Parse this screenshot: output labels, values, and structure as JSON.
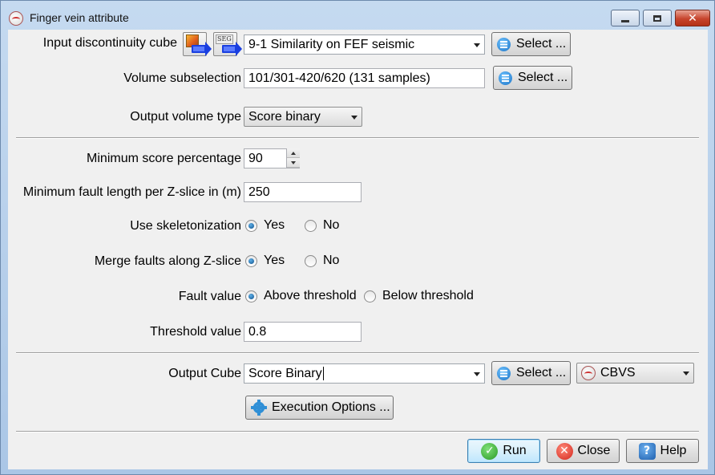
{
  "window": {
    "title": "Finger vein attribute",
    "minimize_glyph": "",
    "restore_glyph": "",
    "close_glyph": "✕"
  },
  "input_cube": {
    "label": "Input discontinuity cube",
    "value": "9-1 Similarity on FEF seismic",
    "select_label": "Select ...",
    "segy_label": "SEG"
  },
  "volume_subselection": {
    "label": "Volume subselection",
    "value": "101/301-420/620 (131 samples)",
    "select_label": "Select ..."
  },
  "output_volume_type": {
    "label": "Output volume type",
    "value": "Score binary"
  },
  "min_score": {
    "label": "Minimum score percentage",
    "value": "90"
  },
  "min_fault_length": {
    "label": "Minimum fault length per Z-slice in (m)",
    "value": "250"
  },
  "skeletonization": {
    "label": "Use skeletonization",
    "yes": "Yes",
    "no": "No",
    "selected": "Yes"
  },
  "merge_faults": {
    "label": "Merge faults along Z-slice",
    "yes": "Yes",
    "no": "No",
    "selected": "Yes"
  },
  "fault_value": {
    "label": "Fault value",
    "above": "Above threshold",
    "below": "Below threshold",
    "selected": "Above threshold"
  },
  "threshold": {
    "label": "Threshold value",
    "value": "0.8"
  },
  "output_cube": {
    "label": "Output Cube",
    "value": "Score Binary",
    "select_label": "Select ...",
    "format": "CBVS"
  },
  "execution_options": {
    "label": "Execution Options ..."
  },
  "footer": {
    "run": "Run",
    "close": "Close",
    "help": "Help"
  }
}
